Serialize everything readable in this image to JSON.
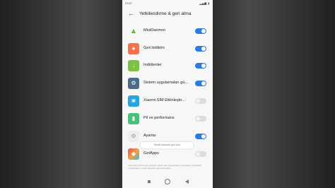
{
  "status_bar": {
    "time": "23:57",
    "icons": "▂▄▆ ▮"
  },
  "header": {
    "back_icon": "arrow-left-icon",
    "title": "Yetkilendirme & geri alma"
  },
  "items": [
    {
      "label": "MiuiDaemon",
      "icon": "android-icon",
      "icon_color": "#7cb342",
      "enabled": true
    },
    {
      "label": "Geri bildirim",
      "icon": "feedback-icon",
      "icon_color": "#f4724b",
      "enabled": true
    },
    {
      "label": "İndirilenler",
      "icon": "download-icon",
      "icon_color": "#7cc143",
      "enabled": true
    },
    {
      "label": "Sistem uygulamaları gü...",
      "icon": "gear-icon",
      "icon_color": "#4a6b8a",
      "enabled": true
    },
    {
      "label": "Xiaomi SIM Etkinleştir...",
      "icon": "sim-icon",
      "icon_color": "#27a5e0",
      "enabled": false
    },
    {
      "label": "Pil ve performans",
      "icon": "battery-icon",
      "icon_color": "#48c27a",
      "enabled": false
    },
    {
      "label": "Ayarlar",
      "icon": "settings-icon",
      "icon_color": "#e8e8e8",
      "enabled": true
    },
    {
      "label": "GetApps",
      "icon": "getapps-icon",
      "icon_color": "#e34a6b",
      "enabled": false
    }
  ],
  "toast": "Tekrar basarak geri alın",
  "footnote": "Yetki alma izinlerini geri alırsanız, sistem bazı uygulamaların çalışmasını durdurabilir. Uygulamaların verileri silinebilir veya sıfırlanabilir."
}
